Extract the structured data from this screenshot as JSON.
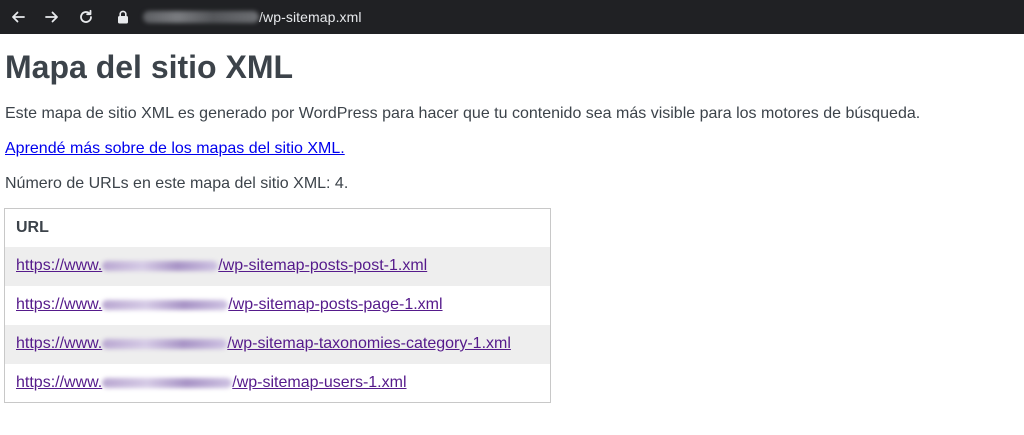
{
  "browser": {
    "url_path": "/wp-sitemap.xml"
  },
  "page": {
    "title": "Mapa del sitio XML",
    "description": "Este mapa de sitio XML es generado por WordPress para hacer que tu contenido sea más visible para los motores de búsqueda.",
    "learn_more_link": "Aprendé más sobre de los mapas del sitio XML.",
    "url_count_text": "Número de URLs en este mapa del sitio XML: 4."
  },
  "table": {
    "header": "URL",
    "rows": [
      {
        "prefix": "https://www.",
        "suffix": "/wp-sitemap-posts-post-1.xml"
      },
      {
        "prefix": "https://www.",
        "suffix": "/wp-sitemap-posts-page-1.xml"
      },
      {
        "prefix": "https://www.",
        "suffix": "/wp-sitemap-taxonomies-category-1.xml"
      },
      {
        "prefix": "https://www.",
        "suffix": "/wp-sitemap-users-1.xml"
      }
    ]
  },
  "colors": {
    "chrome_bg": "#202124",
    "text": "#3c434a",
    "link_unvisited": "#0000ee",
    "link_visited": "#551a8b",
    "row_stripe": "#eeeeee",
    "table_border": "#c8c8c8"
  },
  "icons": [
    "back-arrow-icon",
    "forward-arrow-icon",
    "reload-icon",
    "lock-icon"
  ]
}
